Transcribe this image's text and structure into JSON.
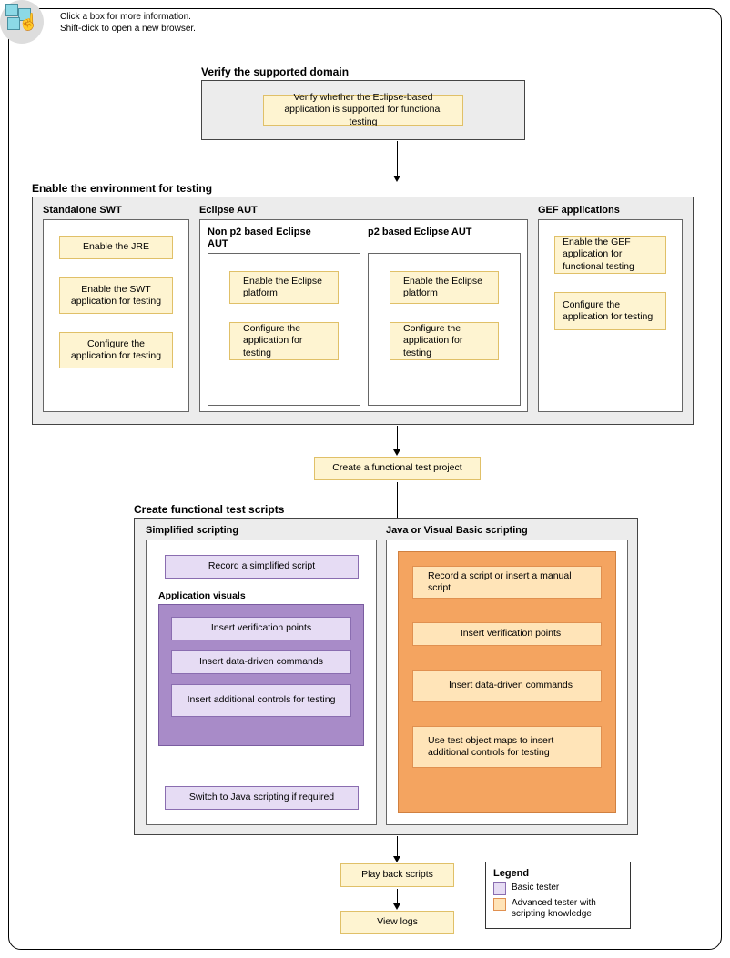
{
  "help": {
    "line1": "Click a box for more information.",
    "line2": "Shift-click to open a new browser."
  },
  "verify": {
    "title": "Verify the supported domain",
    "box": "Verify whether the Eclipse-based application is supported for functional testing"
  },
  "enable": {
    "title": "Enable the environment for testing",
    "swt": {
      "title": "Standalone SWT",
      "b1": "Enable the JRE",
      "b2": "Enable the SWT application for testing",
      "b3": "Configure the application for testing"
    },
    "aut": {
      "title": "Eclipse AUT",
      "nonp2": {
        "title": "Non p2 based Eclipse AUT",
        "b1": "Enable the Eclipse platform",
        "b2": "Configure the application for testing"
      },
      "p2": {
        "title": "p2 based Eclipse AUT",
        "b1": "Enable the Eclipse platform",
        "b2": "Configure the application for testing"
      }
    },
    "gef": {
      "title": "GEF applications",
      "b1": "Enable the GEF application for functional testing",
      "b2": "Configure the application for testing"
    }
  },
  "create_project": "Create a functional test project",
  "scripts": {
    "title": "Create functional test scripts",
    "simplified": {
      "title": "Simplified scripting",
      "record": "Record a simplified script",
      "visuals_title": "Application visuals",
      "v1": "Insert verification points",
      "v2": "Insert data-driven commands",
      "v3": "Insert additional controls for testing",
      "switch": "Switch to Java scripting if required"
    },
    "java": {
      "title": "Java or Visual Basic scripting",
      "b1": "Record a script or insert a manual script",
      "b2": "Insert verification points",
      "b3": "Insert data-driven commands",
      "b4": "Use test object maps to insert additional controls for testing"
    }
  },
  "playback": "Play back scripts",
  "viewlogs": "View logs",
  "legend": {
    "title": "Legend",
    "basic": "Basic tester",
    "advanced": "Advanced tester with scripting knowledge"
  }
}
